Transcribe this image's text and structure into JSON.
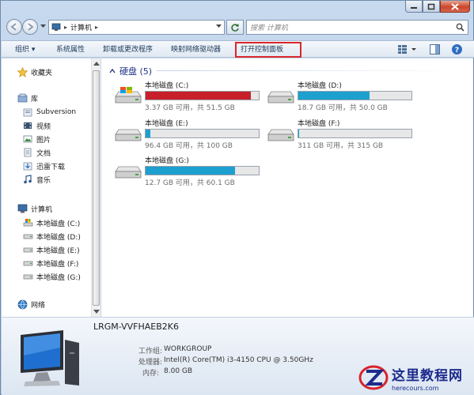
{
  "address": {
    "path_item": "计算机",
    "search_placeholder": "搜索 计算机"
  },
  "toolbar": {
    "organize": "组织 ▾",
    "system_properties": "系统属性",
    "uninstall": "卸载或更改程序",
    "map_drive": "映射网络驱动器",
    "open_control_panel": "打开控制面板"
  },
  "nav": {
    "favorites": "收藏夹",
    "libraries": "库",
    "lib_items": [
      "Subversion",
      "视频",
      "图片",
      "文档",
      "迅雷下载",
      "音乐"
    ],
    "computer": "计算机",
    "drives": [
      "本地磁盘 (C:)",
      "本地磁盘 (D:)",
      "本地磁盘 (E:)",
      "本地磁盘 (F:)",
      "本地磁盘 (G:)"
    ],
    "network": "网络"
  },
  "content": {
    "group_title": "硬盘 (5)",
    "drives": [
      {
        "name": "本地磁盘 (C:)",
        "info": "3.37 GB 可用，共 51.5 GB",
        "used_fraction": 0.93,
        "color": "#c8202b"
      },
      {
        "name": "本地磁盘 (D:)",
        "info": "18.7 GB 可用，共 50.0 GB",
        "used_fraction": 0.63,
        "color": "#1d9fcf"
      },
      {
        "name": "本地磁盘 (E:)",
        "info": "96.4 GB 可用，共 100 GB",
        "used_fraction": 0.04,
        "color": "#1d9fcf"
      },
      {
        "name": "本地磁盘 (F:)",
        "info": "311 GB 可用，共 315 GB",
        "used_fraction": 0.01,
        "color": "#1d9fcf"
      },
      {
        "name": "本地磁盘 (G:)",
        "info": "12.7 GB 可用，共 60.1 GB",
        "used_fraction": 0.79,
        "color": "#1d9fcf"
      }
    ]
  },
  "details": {
    "pc_name": "LRGM-VVFHAEB2K6",
    "workgroup_label": "工作组:",
    "workgroup_value": "WORKGROUP",
    "cpu_label": "处理器:",
    "cpu_value": "Intel(R) Core(TM) i3-4150 CPU @ 3.50GHz",
    "memory_label": "内存:",
    "memory_value": "8.00 GB"
  },
  "watermark": {
    "title": "这里教程网",
    "url": "herecours.com"
  },
  "colors": {
    "accent": "#1d9fcf",
    "critical": "#c8202b",
    "highlight_box": "#d9272c"
  }
}
